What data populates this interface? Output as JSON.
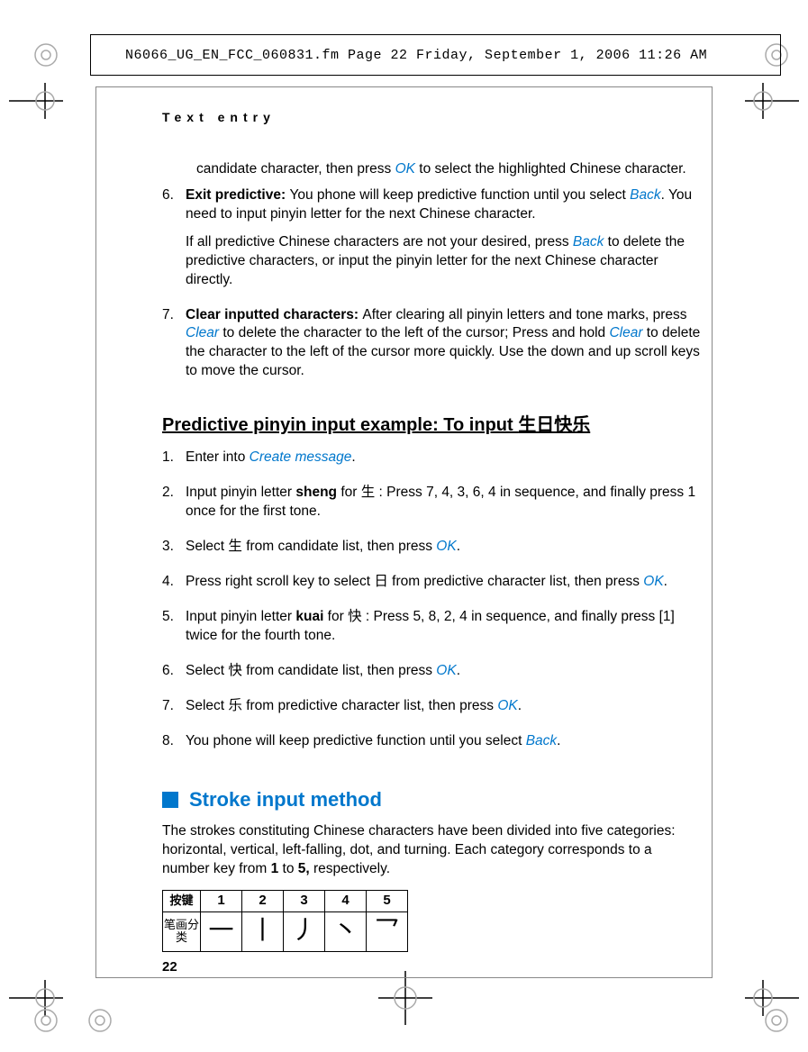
{
  "meta": {
    "header_line": "N6066_UG_EN_FCC_060831.fm  Page 22  Friday, September 1, 2006  11:26 AM",
    "running_head": "Text entry",
    "page_number": "22"
  },
  "cont": {
    "p1a": "candidate character, then press ",
    "p1_link": "OK",
    "p1b": " to select the highlighted Chinese character."
  },
  "item6": {
    "num": "6.",
    "bold": "Exit predictive: ",
    "p1a": "You phone will keep predictive function until you select ",
    "p1_link": "Back",
    "p1b": ". You need to input pinyin letter for the next Chinese character.",
    "p2a": "If all predictive Chinese characters are not your desired, press ",
    "p2_link": "Back",
    "p2b": " to delete the predictive characters, or input the pinyin letter for the next Chinese character directly."
  },
  "item7": {
    "num": "7.",
    "bold": "Clear inputted characters: ",
    "p1a": "After clearing all pinyin letters and tone marks, press ",
    "p1_link1": "Clear",
    "p1b": " to delete the character to the left of the cursor; Press and hold ",
    "p1_link2": "Clear",
    "p1c": " to delete the character to the left of the cursor more quickly. Use the down and up scroll keys to move the cursor."
  },
  "h2": {
    "text": "Predictive pinyin input example: To input ",
    "cjk": "生日快乐"
  },
  "ex": {
    "i1": {
      "n": "1.",
      "a": "Enter into ",
      "link": "Create message",
      "b": "."
    },
    "i2": {
      "n": "2.",
      "a": "Input pinyin letter ",
      "bold": "sheng",
      "b": " for ",
      "cjk": "生",
      "c": " : Press 7, 4, 3, 6, 4 in sequence, and finally press 1 once for the first tone."
    },
    "i3": {
      "n": "3.",
      "a": "Select ",
      "cjk": "生",
      "b": " from candidate list, then press ",
      "link": "OK",
      "c": "."
    },
    "i4": {
      "n": "4.",
      "a": "Press right scroll key to select ",
      "cjk": "日",
      "b": " from predictive character list, then press ",
      "link": "OK",
      "c": "."
    },
    "i5": {
      "n": "5.",
      "a": "Input pinyin letter ",
      "bold": "kuai",
      "b": " for ",
      "cjk": "快",
      "c": " : Press 5, 8, 2, 4 in sequence, and finally press [1] twice for the fourth tone."
    },
    "i6": {
      "n": "6.",
      "a": "Select ",
      "cjk": "快",
      "b": " from candidate list, then press ",
      "link": "OK",
      "c": "."
    },
    "i7": {
      "n": "7.",
      "a": "Select ",
      "cjk": "乐",
      "b": " from predictive character list, then press ",
      "link": "OK",
      "c": "."
    },
    "i8": {
      "n": "8.",
      "a": "You phone will keep predictive function until you select ",
      "link": "Back",
      "b": "."
    }
  },
  "section": {
    "title": "Stroke input method",
    "p": "The strokes constituting Chinese characters have been divided into five categories: horizontal, vertical, left-falling, dot, and turning. Each category corresponds to a number key from ",
    "b1": "1",
    "mid": " to ",
    "b2": "5,",
    "end": " respectively."
  },
  "table": {
    "row_key": "按键",
    "row_cat": "笔画分类",
    "h1": "1",
    "h2": "2",
    "h3": "3",
    "h4": "4",
    "h5": "5",
    "s1": "一",
    "s2": "丨",
    "s3": "丿",
    "s4": "丶",
    "s5": "乛"
  }
}
